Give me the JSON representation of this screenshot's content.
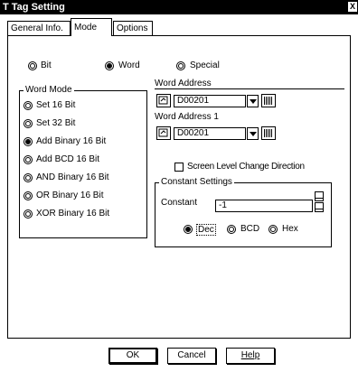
{
  "window": {
    "title": "T Tag Setting",
    "close_glyph": "X"
  },
  "tabs": [
    {
      "label": "General Info."
    },
    {
      "label": "Mode"
    },
    {
      "label": "Options"
    }
  ],
  "mode_options": {
    "bit": "Bit",
    "word": "Word",
    "special": "Special",
    "selected": "Word"
  },
  "word_mode": {
    "title": "Word Mode",
    "items": [
      "Set 16 Bit",
      "Set 32 Bit",
      "Add Binary 16 Bit",
      "Add BCD 16 Bit",
      "AND Binary 16 Bit",
      "OR Binary 16 Bit",
      "XOR Binary 16 Bit"
    ],
    "selected": "Add Binary 16 Bit"
  },
  "word_address": {
    "label": "Word Address",
    "value": "D00201"
  },
  "word_address_1": {
    "label": "Word Address 1",
    "value": "D00201"
  },
  "screen_level": {
    "label": "Screen Level Change Direction",
    "checked": false
  },
  "constant_settings": {
    "title": "Constant Settings",
    "label": "Constant",
    "value": "-1",
    "formats": [
      "Dec",
      "BCD",
      "Hex"
    ],
    "selected": "Dec"
  },
  "buttons": {
    "ok": "OK",
    "cancel": "Cancel",
    "help": "Help"
  }
}
